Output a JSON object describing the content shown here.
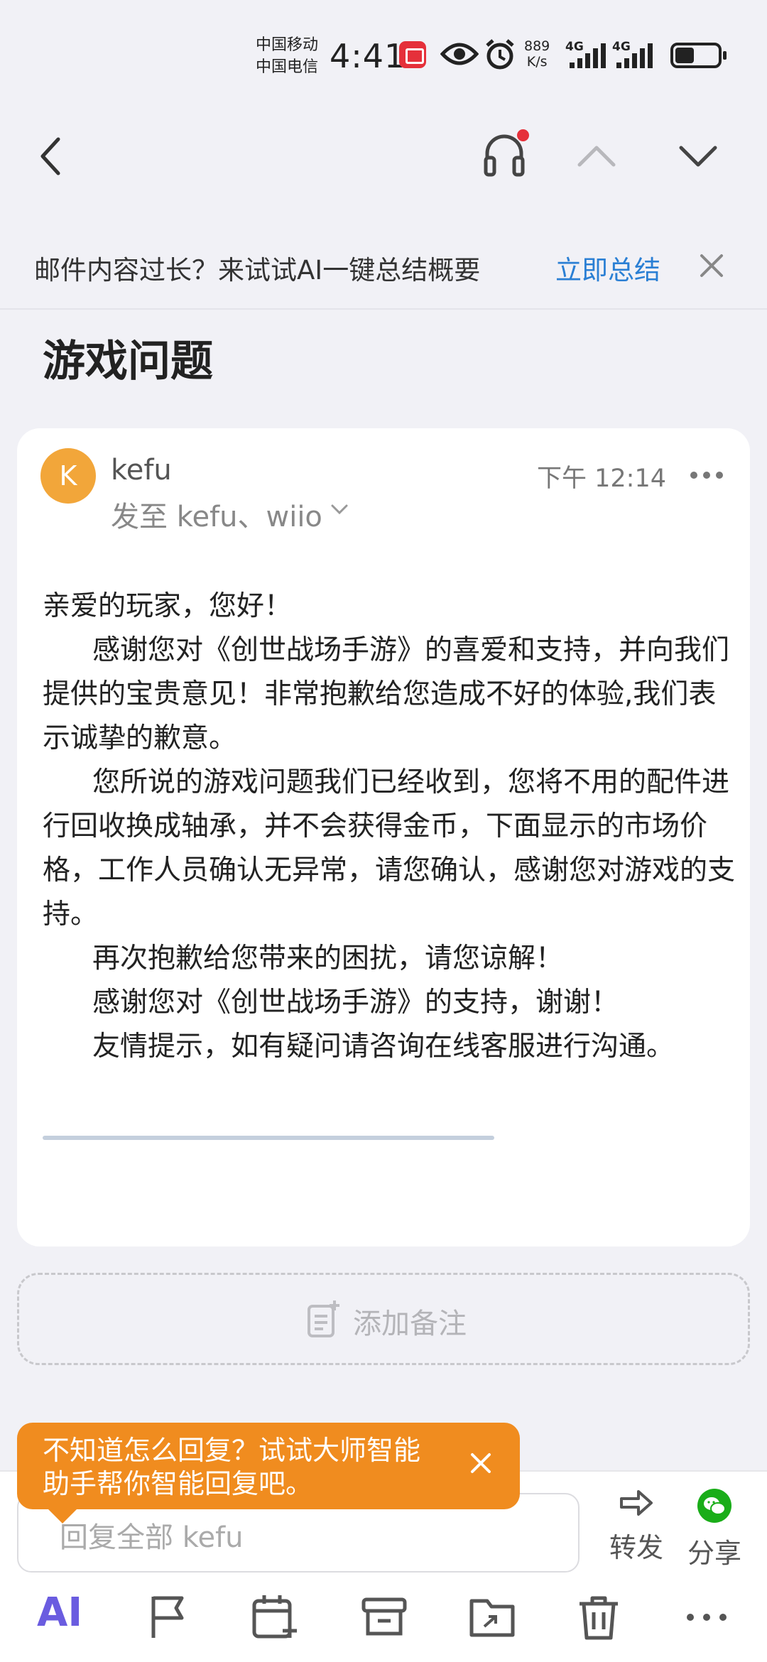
{
  "status_bar": {
    "carrier_1": "中国移动",
    "carrier_2": "中国电信",
    "time": "4:41",
    "net_speed_value": "889",
    "net_speed_unit": "K/s",
    "signal_1_label": "4G",
    "signal_2_label": "4G",
    "icons": [
      "app-badge-icon",
      "eye-icon",
      "alarm-icon",
      "signal-icon",
      "signal-icon",
      "battery-icon"
    ]
  },
  "nav": {
    "icons": [
      "back-icon",
      "headset-icon",
      "chevron-up-icon",
      "chevron-down-icon"
    ],
    "notification_dot_color": "#e5303a"
  },
  "ai_banner": {
    "text": "邮件内容过长？来试试AI一键总结概要",
    "action": "立即总结",
    "action_color": "#2a7fd4"
  },
  "subject": "游戏问题",
  "mail": {
    "avatar_letter": "K",
    "avatar_color": "#f2a63a",
    "sender": "kefu",
    "recipients": "发至 kefu、wiio",
    "time": "下午 12:14",
    "body": {
      "p1": "亲爱的玩家，您好！",
      "p2": "感谢您对《创世战场手游》的喜爱和支持，并向我们提供的宝贵意见！非常抱歉给您造成不好的体验,我们表示诚挚的歉意。",
      "p3": "您所说的游戏问题我们已经收到，您将不用的配件进行回收换成轴承，并不会获得金币，下面显示的市场价格，工作人员确认无异常，请您确认，感谢您对游戏的支持。",
      "p4": "再次抱歉给您带来的困扰，请您谅解！",
      "p5": "感谢您对《创世战场手游》的支持，谢谢！",
      "p6": "友情提示，如有疑问请咨询在线客服进行沟通。"
    }
  },
  "add_note": {
    "label": "添加备注"
  },
  "reply": {
    "placeholder": "回复全部 kefu",
    "forward_label": "转发",
    "share_label": "分享",
    "share_color": "#1aad19"
  },
  "toolbar": {
    "ai_label": "AI",
    "icons": [
      "ai-icon",
      "flag-icon",
      "calendar-add-icon",
      "archive-icon",
      "move-folder-icon",
      "trash-icon",
      "more-icon"
    ]
  },
  "tooltip": {
    "text": "不知道怎么回复？试试大师智能助手帮你智能回复吧。",
    "color": "#f08c1f"
  }
}
